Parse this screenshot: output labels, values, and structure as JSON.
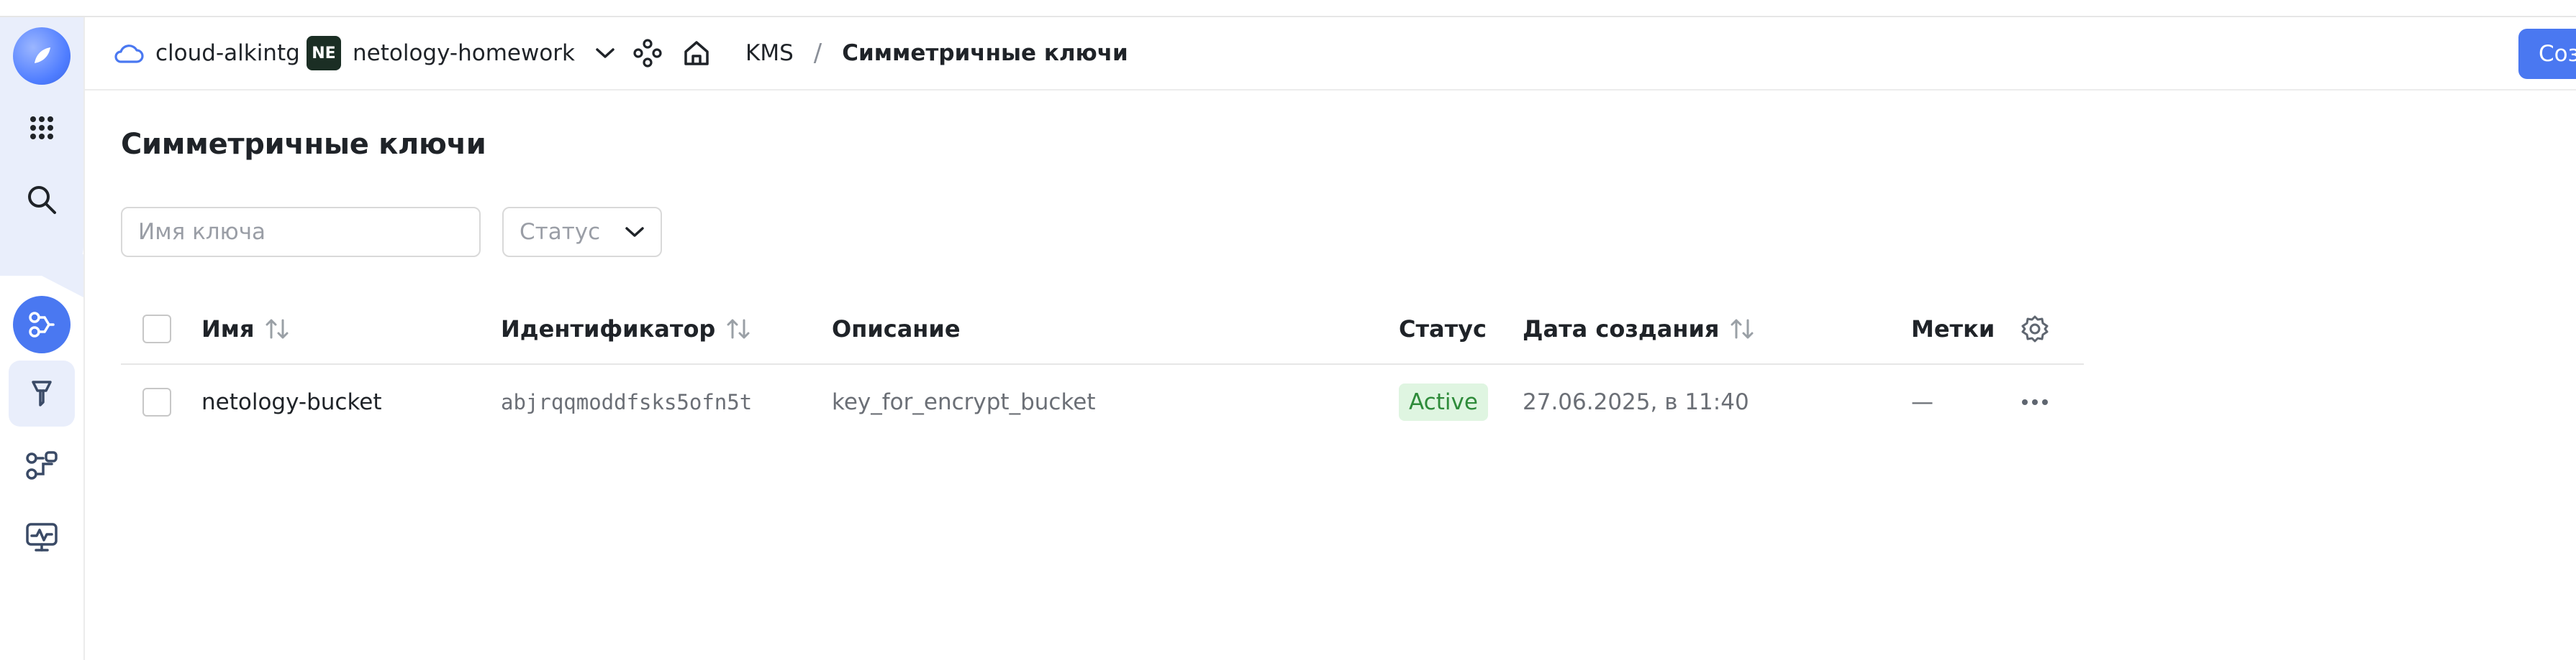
{
  "header": {
    "cloud_name": "cloud-alkintg",
    "folder_badge": "NE",
    "folder_name": "netology-homework",
    "service": "KMS",
    "separator": "/",
    "current_page": "Симметричные ключи",
    "create_button": "Соз"
  },
  "page": {
    "title": "Симметричные ключи"
  },
  "filters": {
    "name_placeholder": "Имя ключа",
    "status_placeholder": "Статус"
  },
  "table": {
    "columns": {
      "name": "Имя",
      "id": "Идентификатор",
      "description": "Описание",
      "status": "Статус",
      "created": "Дата создания",
      "labels": "Метки"
    },
    "rows": [
      {
        "name": "netology-bucket",
        "id": "abjrqqmoddfsks5ofn5t",
        "description": "key_for_encrypt_bucket",
        "status": "Active",
        "created": "27.06.2025, в 11:40",
        "labels": "—"
      }
    ]
  },
  "colors": {
    "accent": "#4a78f1",
    "rail_bg": "#e9eefb",
    "active_badge_bg": "#dff5e1",
    "active_badge_text": "#2e8b3a"
  },
  "icons": {
    "rail": [
      "logo-icon",
      "apps-grid-icon",
      "search-icon",
      "kms-service-icon",
      "key-icon",
      "keys-network-icon",
      "monitoring-icon"
    ],
    "header": [
      "cloud-icon",
      "chevron-down-icon",
      "services-icon",
      "home-icon"
    ]
  }
}
